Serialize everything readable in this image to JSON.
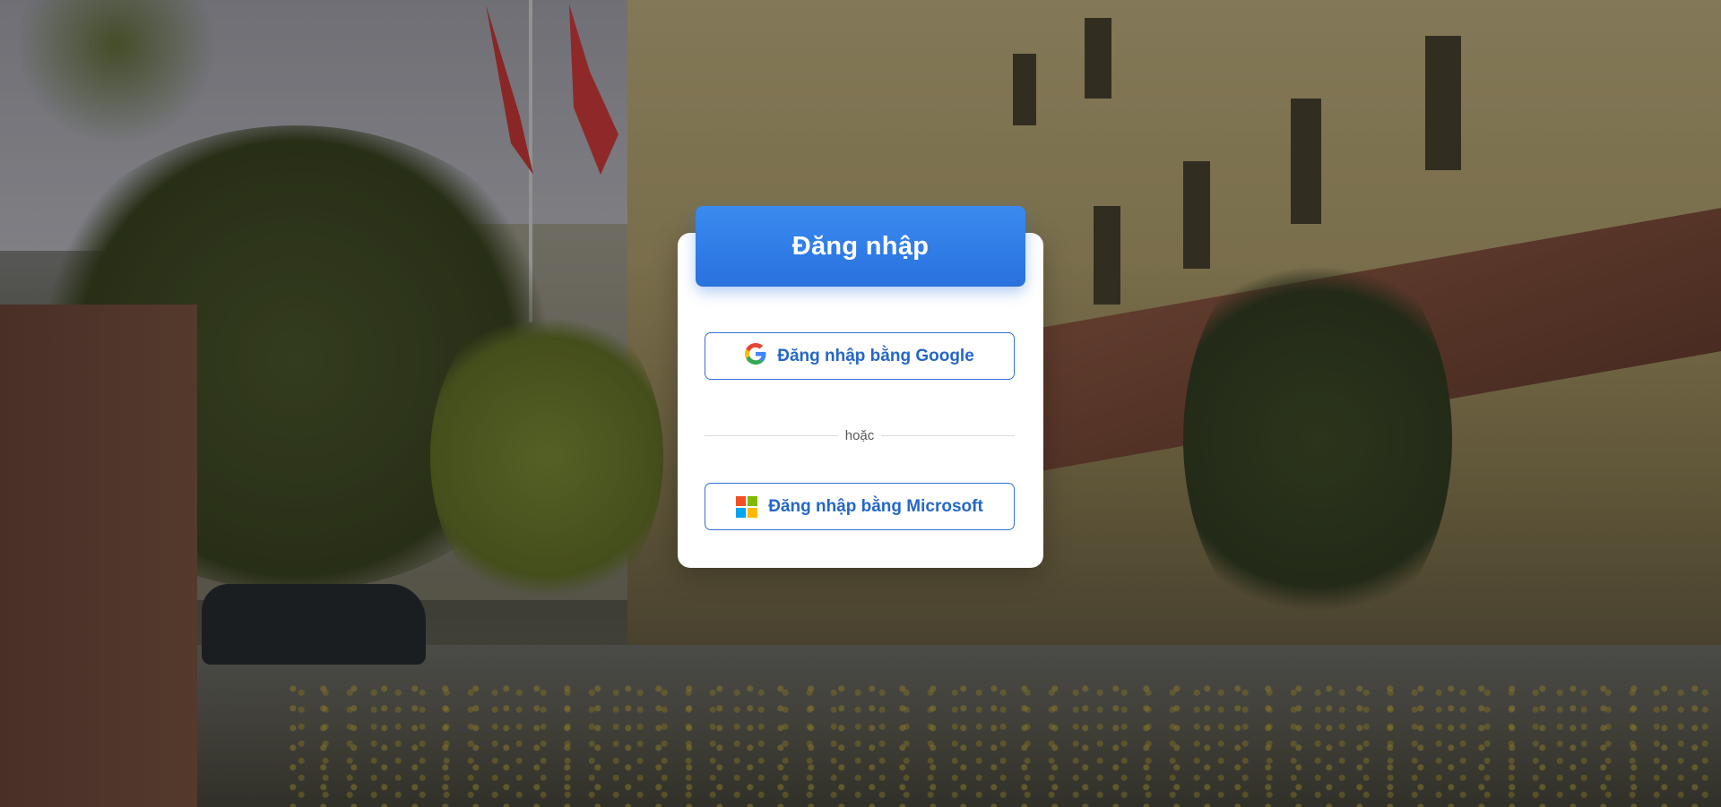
{
  "login": {
    "title": "Đăng nhập",
    "google_button_label": "Đăng nhập bằng Google",
    "divider_text": "hoặc",
    "microsoft_button_label": "Đăng nhập bằng Microsoft"
  },
  "icons": {
    "google": "google-icon",
    "microsoft": "microsoft-icon"
  },
  "colors": {
    "header_blue": "#2f7be6",
    "button_text_blue": "#2467c9",
    "button_border_blue": "#2d6fd8",
    "google_blue": "#4285F4",
    "google_red": "#EA4335",
    "google_yellow": "#FBBC05",
    "google_green": "#34A853",
    "ms_red": "#F25022",
    "ms_green": "#7FBA00",
    "ms_blue": "#00A4EF",
    "ms_yellow": "#FFB900"
  }
}
